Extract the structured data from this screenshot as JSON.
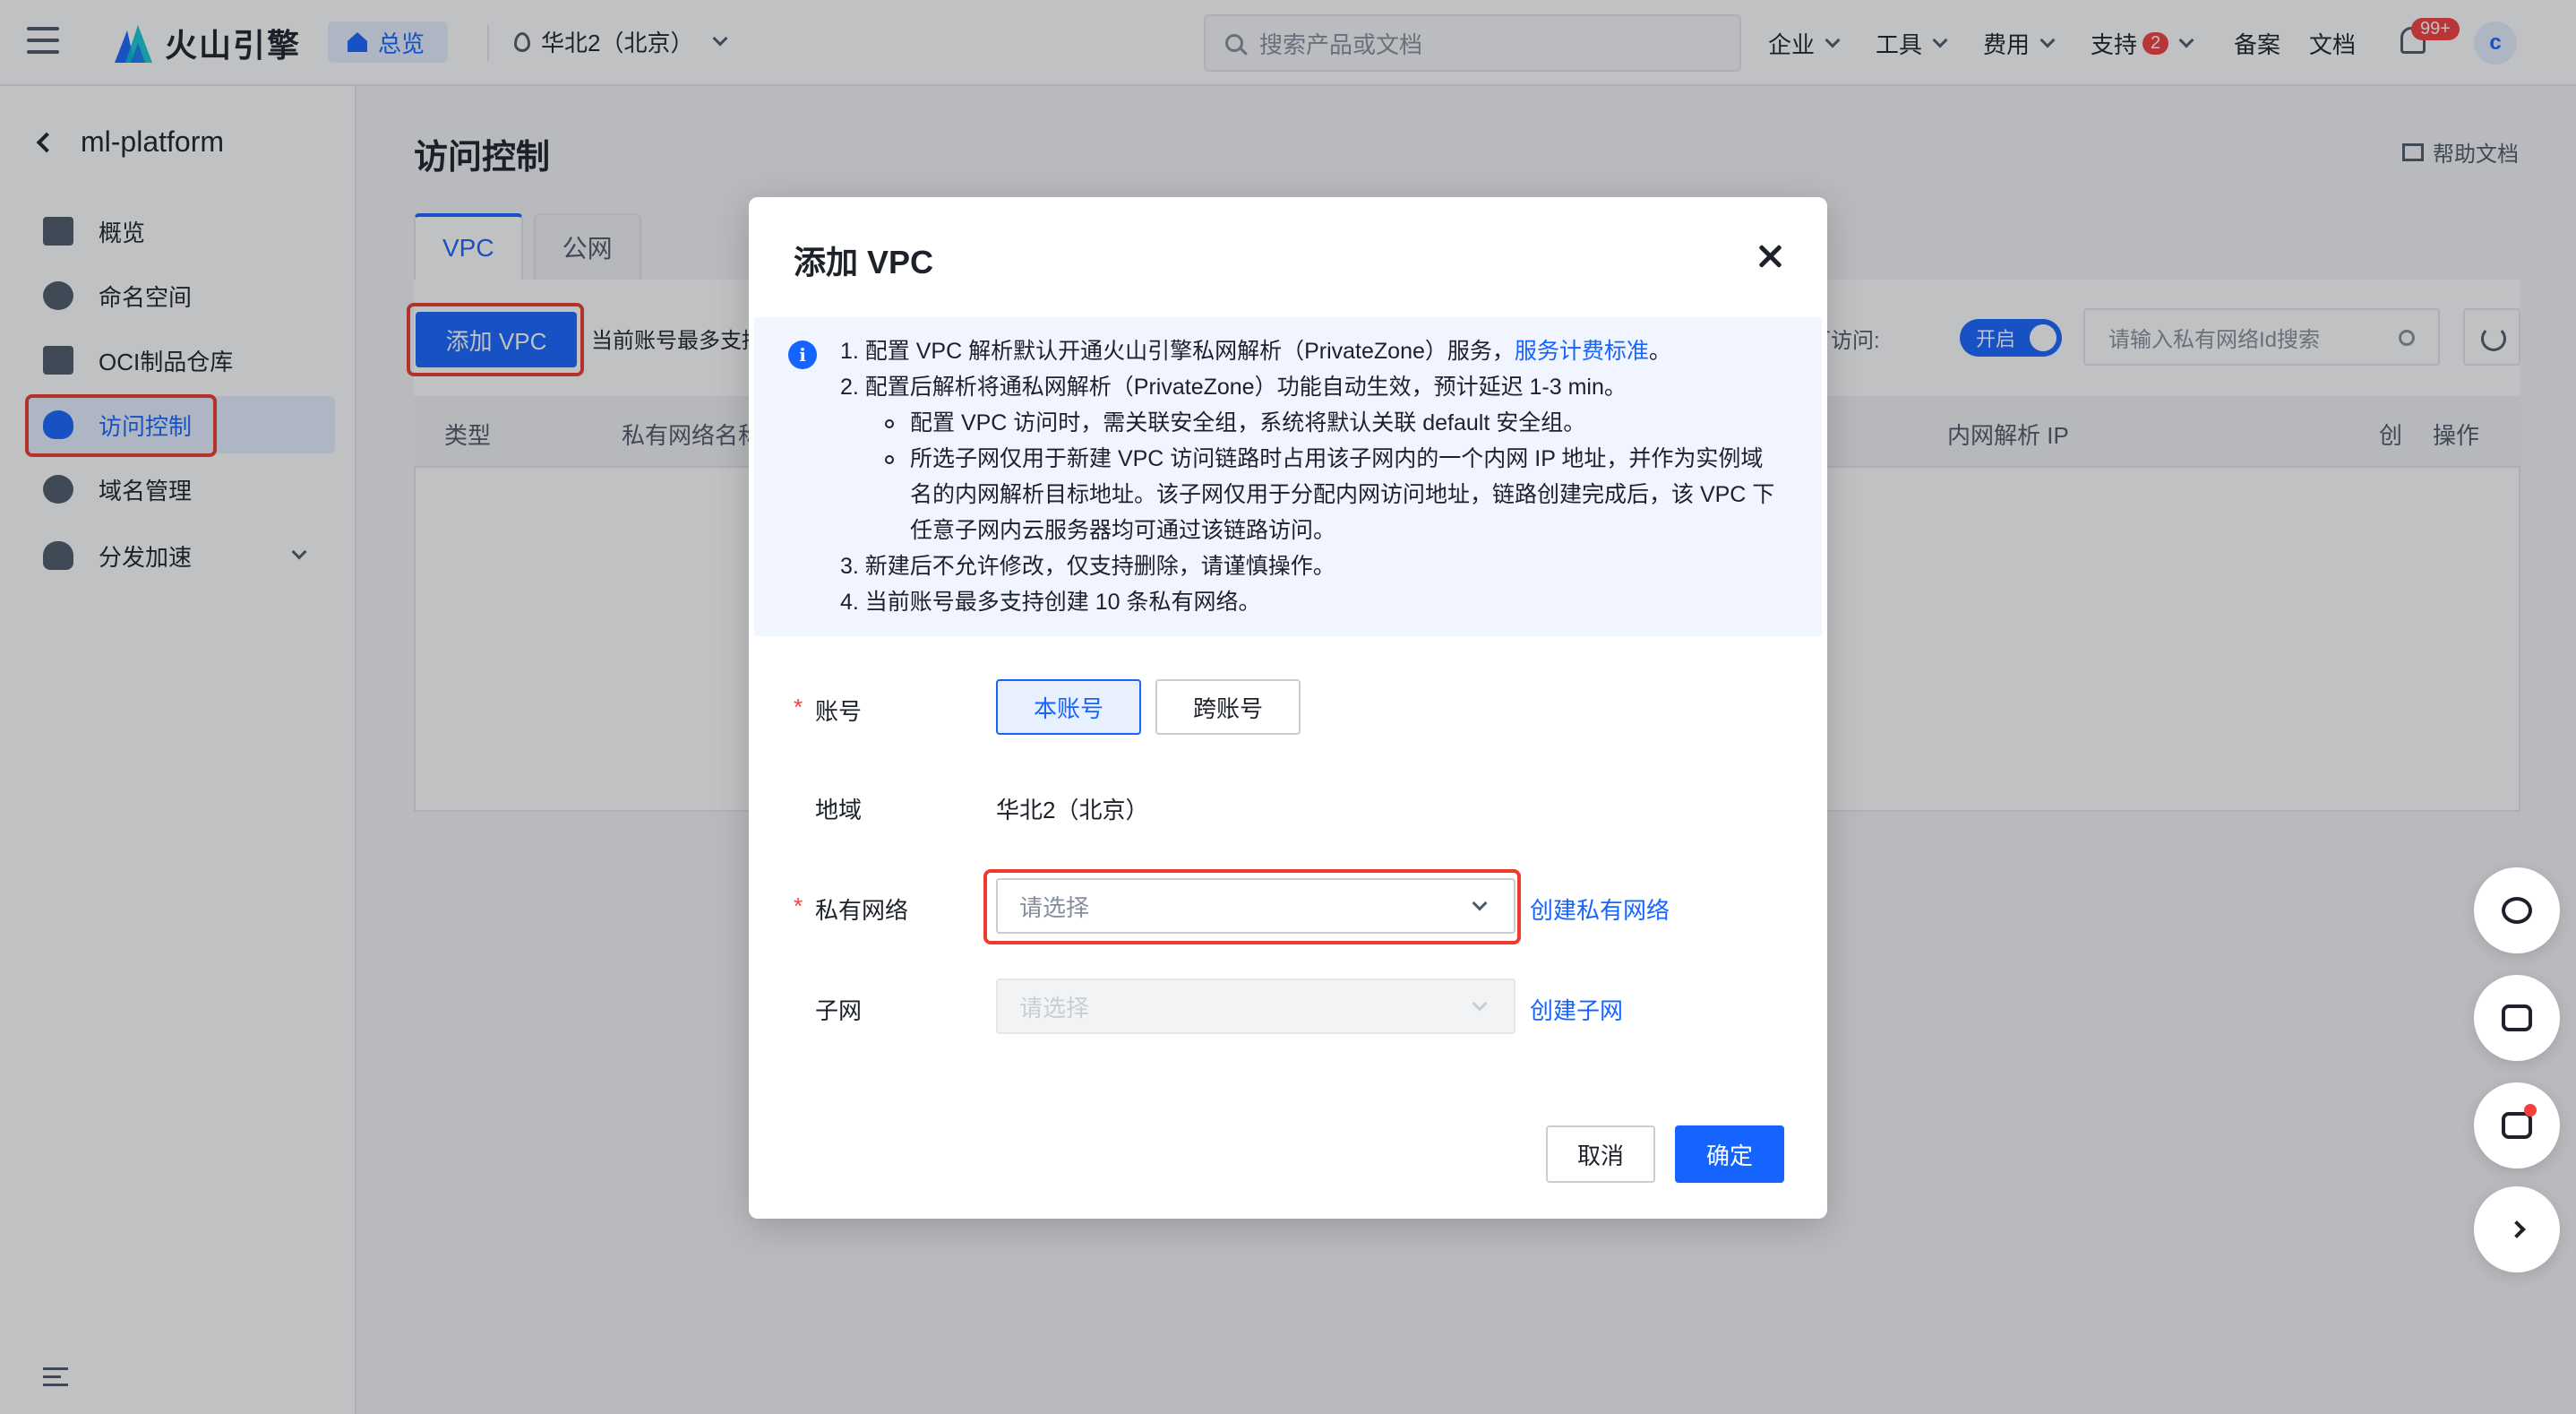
{
  "topbar": {
    "brand": "火山引擎",
    "overview": "总览",
    "region": "华北2（北京）",
    "search_placeholder": "搜索产品或文档",
    "nav": {
      "enterprise": "企业",
      "tools": "工具",
      "cost": "费用",
      "support": "支持",
      "support_badge": "2",
      "filing": "备案",
      "docs": "文档"
    },
    "notification_badge": "99+",
    "avatar": "c"
  },
  "sidebar": {
    "title": "ml-platform",
    "items": [
      {
        "label": "概览",
        "icon": "house-icon"
      },
      {
        "label": "命名空间",
        "icon": "namespace-icon"
      },
      {
        "label": "OCI制品仓库",
        "icon": "repository-icon"
      },
      {
        "label": "访问控制",
        "icon": "shield-icon"
      },
      {
        "label": "域名管理",
        "icon": "domain-icon"
      },
      {
        "label": "分发加速",
        "icon": "cloud-icon"
      }
    ]
  },
  "main": {
    "title": "访问控制",
    "help_doc": "帮助文档",
    "tabs": [
      "VPC",
      "公网"
    ],
    "add_button": "添加 VPC",
    "note": "当前账号最多支持",
    "toggle_label": "可访问:",
    "toggle_value": "开启",
    "search_placeholder": "请输入私有网络Id搜索",
    "columns": {
      "type": "类型",
      "vpc_name": "私有网络名称",
      "resolve_ip": "内网解析 IP",
      "created": "创",
      "actions": "操作"
    }
  },
  "modal": {
    "title": "添加 VPC",
    "info": {
      "line1": "1. 配置 VPC 解析默认开通火山引擎私网解析（PrivateZone）服务，",
      "line1_link": "服务计费标准",
      "line1_end": "。",
      "line2": "2. 配置后解析将通私网解析（PrivateZone）功能自动生效，预计延迟 1-3 min。",
      "bullet1": "配置 VPC 访问时，需关联安全组，系统将默认关联 default 安全组。",
      "bullet2_a": "所选子网仅用于新建 VPC 访问链路时占用该子网内的一个内网 IP 地址，并作为实例域",
      "bullet2_b": "名的内网解析目标地址。该子网仅用于分配内网访问地址，链路创建完成后，该 VPC 下",
      "bullet2_c": "任意子网内云服务器均可通过该链路访问。",
      "line3": "3. 新建后不允许修改，仅支持删除，请谨慎操作。",
      "line4": "4. 当前账号最多支持创建 10 条私有网络。"
    },
    "form": {
      "account_label": "账号",
      "account_options": [
        "本账号",
        "跨账号"
      ],
      "account_selected": "本账号",
      "region_label": "地域",
      "region_value": "华北2（北京）",
      "vpc_label": "私有网络",
      "vpc_placeholder": "请选择",
      "vpc_create_link": "创建私有网络",
      "subnet_label": "子网",
      "subnet_placeholder": "请选择",
      "subnet_create_link": "创建子网"
    },
    "cancel": "取消",
    "confirm": "确定"
  },
  "colors": {
    "primary": "#1664ff",
    "highlight": "#ee3b2c",
    "danger": "#f53f3f"
  }
}
